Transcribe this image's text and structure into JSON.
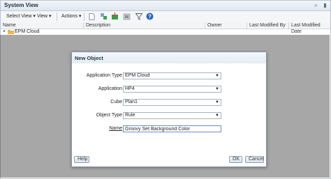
{
  "window": {
    "title": "System View"
  },
  "toolbar": {
    "select_view": "Select View",
    "view": "View",
    "actions": "Actions"
  },
  "table": {
    "columns": [
      "Name",
      "Description",
      "Owner",
      "Last Modified By",
      "Last Modified Date"
    ],
    "rows": [
      {
        "name": "EPM Cloud"
      }
    ]
  },
  "dialog": {
    "title": "New Object",
    "fields": {
      "application_type": {
        "label": "Application Type",
        "value": "EPM Cloud"
      },
      "application": {
        "label": "Application",
        "value": "HP4"
      },
      "cube": {
        "label": "Cube",
        "value": "Plan1"
      },
      "object_type": {
        "label": "Object Type",
        "value": "Rule"
      },
      "name": {
        "label": "Name",
        "value": "Groovy Set Background Color"
      }
    },
    "buttons": {
      "help": "Help",
      "ok": "OK",
      "cancel": "Cancel"
    }
  },
  "colors": {
    "accent": "#1f3347",
    "overlay": "#3c3c3c",
    "help_icon": "#2a64b5"
  }
}
